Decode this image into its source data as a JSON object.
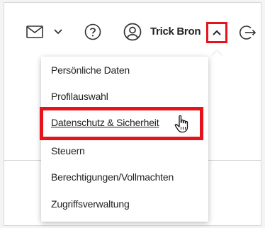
{
  "header": {
    "user_name": "Trick Bron",
    "icons": {
      "mail": "mail-icon",
      "mail_menu": "chevron-down-icon",
      "help": "help-circle-icon",
      "user": "user-circle-icon",
      "toggle": "chevron-up-icon",
      "logout": "logout-icon"
    }
  },
  "menu": {
    "items": [
      {
        "label": "Persönliche Daten"
      },
      {
        "label": "Profilauswahl"
      },
      {
        "label": "Datenschutz & Sicherheit",
        "highlighted": true
      },
      {
        "label": "Steuern"
      },
      {
        "label": "Berechtigungen/Vollmachten"
      },
      {
        "label": "Zugriffsverwaltung"
      }
    ]
  },
  "colors": {
    "highlight": "#e5141c",
    "text": "#1f1f1f",
    "icon": "#333333"
  },
  "cursor": "hand-pointer-icon"
}
